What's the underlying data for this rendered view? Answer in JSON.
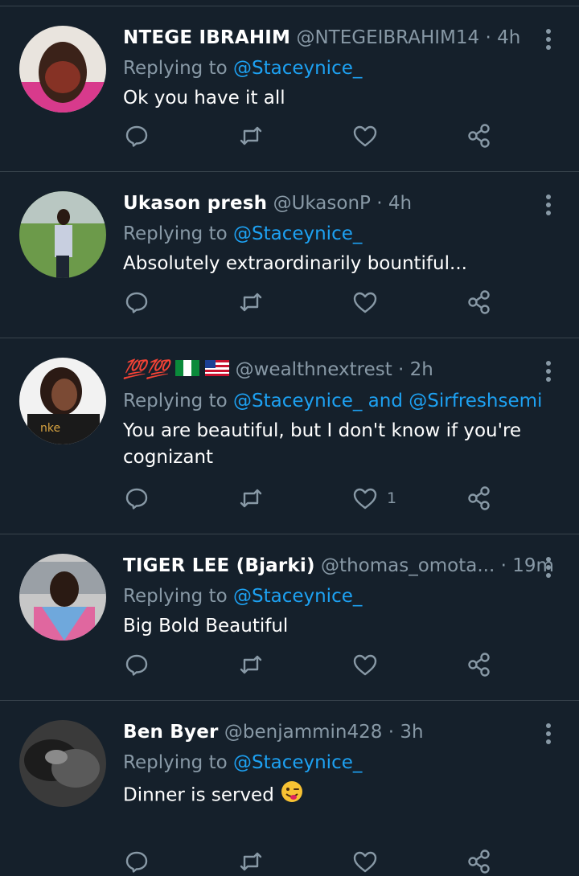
{
  "colors": {
    "background": "#15202b",
    "divider": "#38444d",
    "secondary": "#8899a6",
    "mention": "#1da1f2"
  },
  "tweets": [
    {
      "name": "NTEGE IBRAHIM",
      "handle": "@NTEGEIBRAHIM14",
      "dot": "·",
      "time": "4h",
      "replying_prefix": "Replying to",
      "mention1": "@Staceynice_",
      "and_text": "",
      "mention2": "",
      "text_line1": "Ok you have it all",
      "text_line2": "",
      "like_count": "",
      "avatar_icon": "avatar-photo"
    },
    {
      "name": "Ukason presh",
      "handle": "@UkasonP",
      "dot": "·",
      "time": "4h",
      "replying_prefix": "Replying to",
      "mention1": "@Staceynice_",
      "and_text": "",
      "mention2": "",
      "text_line1": "Absolutely extraordinarily bountiful...",
      "text_line2": "",
      "like_count": "",
      "avatar_icon": "avatar-photo"
    },
    {
      "name": "💯💯",
      "handle": "@wealthnextrest",
      "dot": "·",
      "time": "2h",
      "replying_prefix": "Replying to",
      "mention1": "@Staceynice_",
      "and_text": " and ",
      "mention2": "@Sirfreshsemi",
      "text_line1": "You are beautiful, but I don't know if you're",
      "text_line2": "cognizant",
      "like_count": "1",
      "avatar_icon": "avatar-photo"
    },
    {
      "name": "TIGER LEE (Bjarki)",
      "handle": "@thomas_omota...",
      "dot": "·",
      "time": "19m",
      "replying_prefix": "Replying to",
      "mention1": "@Staceynice_",
      "and_text": "",
      "mention2": "",
      "text_line1": "Big Bold Beautiful",
      "text_line2": "",
      "like_count": "",
      "avatar_icon": "avatar-photo"
    },
    {
      "name": "Ben Byer",
      "handle": "@benjammin428",
      "dot": "·",
      "time": "3h",
      "replying_prefix": "Replying to",
      "mention1": "@Staceynice_",
      "and_text": "",
      "mention2": "",
      "text_line1": "Dinner is served",
      "text_line2": "",
      "like_count": "",
      "avatar_icon": "avatar-photo"
    }
  ],
  "icons": {
    "reply": "reply-icon",
    "retweet": "retweet-icon",
    "like": "heart-icon",
    "share": "share-icon",
    "more": "more-vertical-icon",
    "flags": "nigeria-flag-and-us-flag-icons",
    "emoji": "winking-tongue-emoji-icon"
  }
}
